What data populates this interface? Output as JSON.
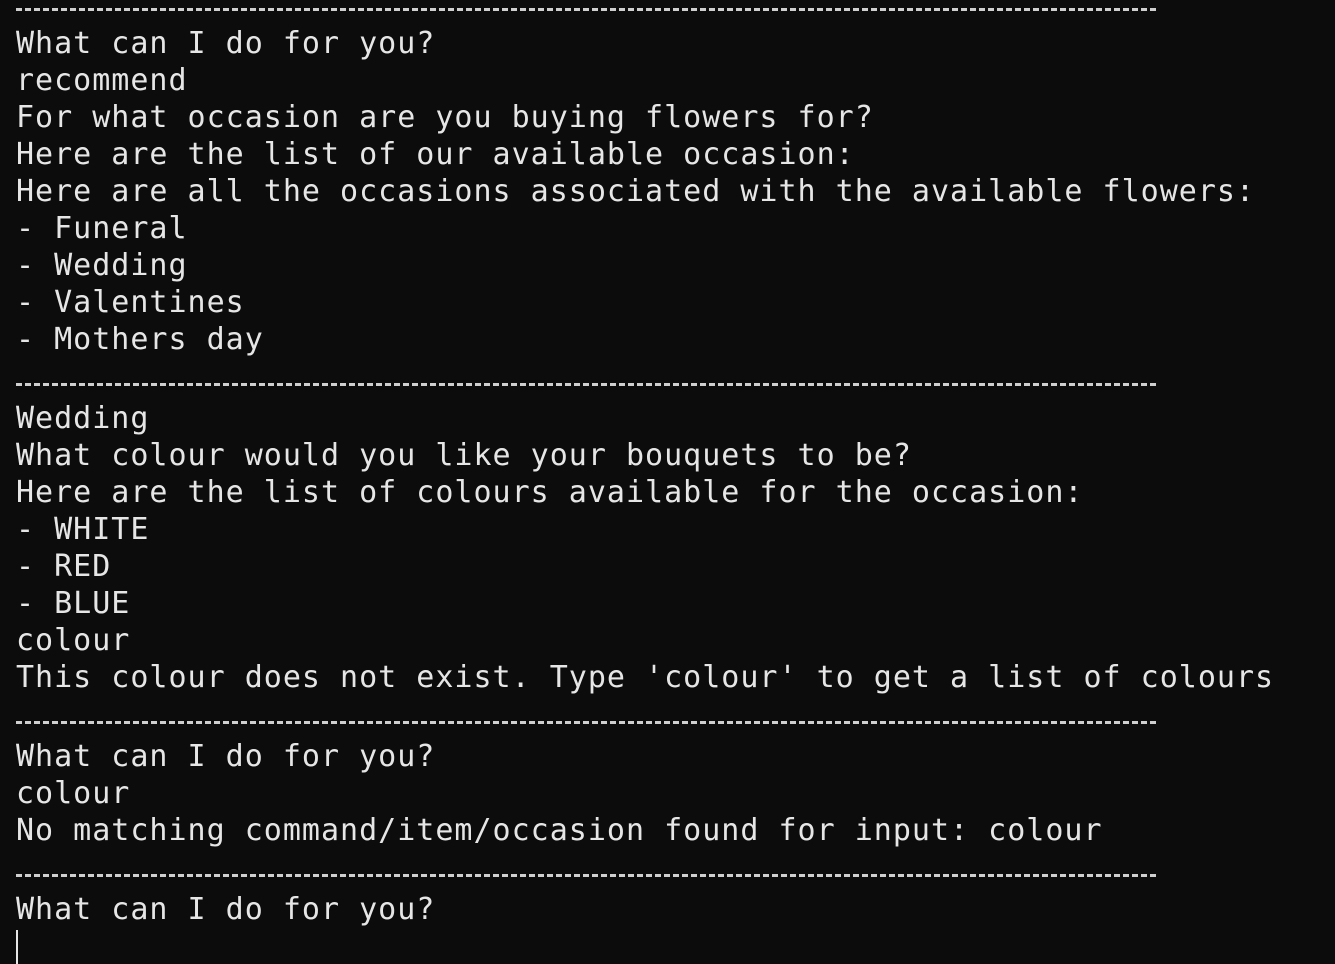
{
  "terminal": {
    "lines": [
      {
        "type": "sep"
      },
      {
        "type": "text",
        "name": "prompt-line",
        "text": "What can I do for you?"
      },
      {
        "type": "text",
        "name": "user-input-line",
        "text": "recommend"
      },
      {
        "type": "text",
        "name": "output-line",
        "text": "For what occasion are you buying flowers for?"
      },
      {
        "type": "text",
        "name": "output-line",
        "text": "Here are the list of our available occasion:"
      },
      {
        "type": "text",
        "name": "output-line",
        "text": "Here are all the occasions associated with the available flowers:"
      },
      {
        "type": "text",
        "name": "list-item",
        "text": "- Funeral"
      },
      {
        "type": "text",
        "name": "list-item",
        "text": "- Wedding"
      },
      {
        "type": "text",
        "name": "list-item",
        "text": "- Valentines"
      },
      {
        "type": "text",
        "name": "list-item",
        "text": "- Mothers day"
      },
      {
        "type": "gap"
      },
      {
        "type": "sep"
      },
      {
        "type": "text",
        "name": "user-input-line",
        "text": "Wedding"
      },
      {
        "type": "text",
        "name": "output-line",
        "text": "What colour would you like your bouquets to be?"
      },
      {
        "type": "text",
        "name": "output-line",
        "text": "Here are the list of colours available for the occasion:"
      },
      {
        "type": "text",
        "name": "list-item",
        "text": "- WHITE"
      },
      {
        "type": "text",
        "name": "list-item",
        "text": "- RED"
      },
      {
        "type": "text",
        "name": "list-item",
        "text": "- BLUE"
      },
      {
        "type": "text",
        "name": "user-input-line",
        "text": "colour"
      },
      {
        "type": "text",
        "name": "error-line",
        "text": "This colour does not exist. Type 'colour' to get a list of colours"
      },
      {
        "type": "gap"
      },
      {
        "type": "sep"
      },
      {
        "type": "text",
        "name": "prompt-line",
        "text": "What can I do for you?"
      },
      {
        "type": "text",
        "name": "user-input-line",
        "text": "colour"
      },
      {
        "type": "text",
        "name": "error-line",
        "text": "No matching command/item/occasion found for input: colour"
      },
      {
        "type": "gap"
      },
      {
        "type": "sep"
      },
      {
        "type": "text",
        "name": "prompt-line",
        "text": "What can I do for you?"
      },
      {
        "type": "cursor"
      }
    ]
  }
}
